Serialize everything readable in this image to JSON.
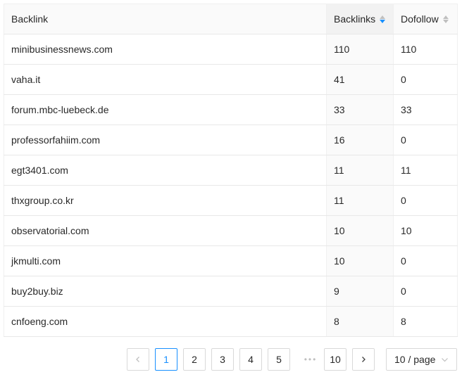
{
  "table": {
    "columns": {
      "backlink": "Backlink",
      "backlinks": "Backlinks",
      "dofollow": "Dofollow"
    },
    "sort": {
      "column": "backlinks",
      "direction": "descending",
      "active_color": "#1890ff"
    },
    "rows": [
      {
        "domain": "minibusinessnews.com",
        "backlinks": "110",
        "dofollow": "110"
      },
      {
        "domain": "vaha.it",
        "backlinks": "41",
        "dofollow": "0"
      },
      {
        "domain": "forum.mbc-luebeck.de",
        "backlinks": "33",
        "dofollow": "33"
      },
      {
        "domain": "professorfahiim.com",
        "backlinks": "16",
        "dofollow": "0"
      },
      {
        "domain": "egt3401.com",
        "backlinks": "11",
        "dofollow": "11"
      },
      {
        "domain": "thxgroup.co.kr",
        "backlinks": "11",
        "dofollow": "0"
      },
      {
        "domain": "observatorial.com",
        "backlinks": "10",
        "dofollow": "10"
      },
      {
        "domain": "jkmulti.com",
        "backlinks": "10",
        "dofollow": "0"
      },
      {
        "domain": "buy2buy.biz",
        "backlinks": "9",
        "dofollow": "0"
      },
      {
        "domain": "cnfoeng.com",
        "backlinks": "8",
        "dofollow": "8"
      }
    ]
  },
  "pagination": {
    "prev_icon": "chevron-left-icon",
    "next_icon": "chevron-right-icon",
    "pages": [
      "1",
      "2",
      "3",
      "4",
      "5"
    ],
    "current": "1",
    "ellipsis": "•••",
    "last_page": "10",
    "page_size": "10 / page",
    "page_size_icon": "chevron-down-icon"
  }
}
